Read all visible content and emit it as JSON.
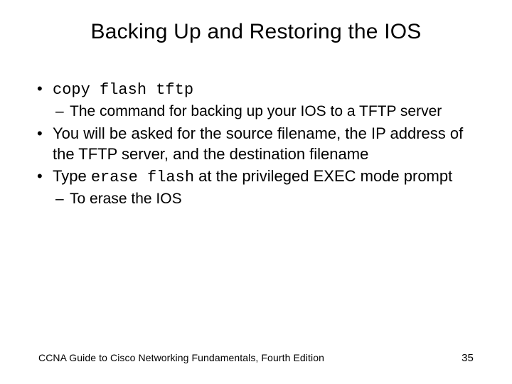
{
  "title": "Backing Up and Restoring the IOS",
  "bullets": {
    "b0_code": "copy flash tftp",
    "b0_sub": "The command for backing up your IOS to a TFTP server",
    "b1": "You will be asked for the source filename, the IP address of the TFTP server, and the destination filename",
    "b2_pre": "Type ",
    "b2_code": "erase flash",
    "b2_post": " at the privileged EXEC mode prompt",
    "b2_sub": "To erase the IOS"
  },
  "footer": {
    "book": "CCNA Guide to Cisco Networking Fundamentals, Fourth Edition",
    "page": "35"
  }
}
